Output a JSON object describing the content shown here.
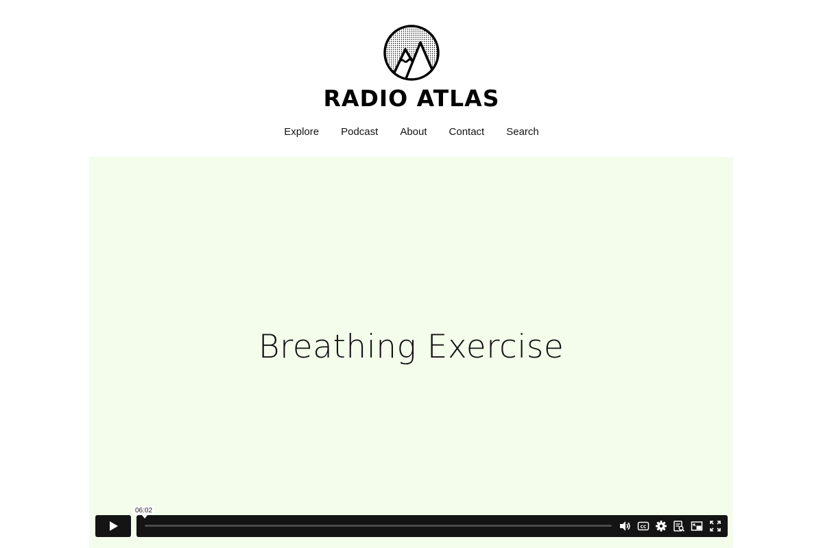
{
  "header": {
    "brand": "RADIO ATLAS",
    "nav": [
      "Explore",
      "Podcast",
      "About",
      "Contact",
      "Search"
    ]
  },
  "video": {
    "title": "Breathing Exercise",
    "time_tooltip": "06:02",
    "progress_fraction": 0.0,
    "background": "#f4fdec"
  },
  "icons": {
    "logo": "mountain-logo",
    "play": "play-icon",
    "volume": "volume-icon",
    "captions": "closed-captions-icon",
    "settings": "gear-icon",
    "transcript": "transcript-icon",
    "pip": "picture-in-picture-icon",
    "fullscreen": "fullscreen-icon"
  }
}
